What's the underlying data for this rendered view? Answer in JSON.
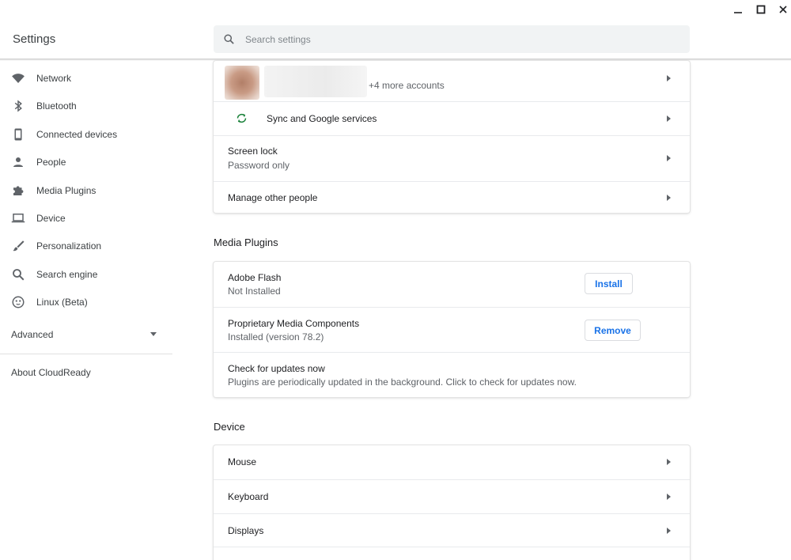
{
  "app": {
    "title": "Settings"
  },
  "search": {
    "placeholder": "Search settings"
  },
  "sidebar": {
    "items": [
      {
        "label": "Network",
        "icon": "wifi-icon"
      },
      {
        "label": "Bluetooth",
        "icon": "bluetooth-icon"
      },
      {
        "label": "Connected devices",
        "icon": "phone-icon"
      },
      {
        "label": "People",
        "icon": "person-icon"
      },
      {
        "label": "Media Plugins",
        "icon": "puzzle-icon"
      },
      {
        "label": "Device",
        "icon": "laptop-icon"
      },
      {
        "label": "Personalization",
        "icon": "brush-icon"
      },
      {
        "label": "Search engine",
        "icon": "search-icon"
      },
      {
        "label": "Linux (Beta)",
        "icon": "penguin-icon"
      }
    ],
    "advanced": "Advanced",
    "about": "About CloudReady"
  },
  "people": {
    "accounts_more": "+4 more accounts",
    "sync": "Sync and Google services",
    "screen_lock": "Screen lock",
    "screen_lock_sub": "Password only",
    "manage": "Manage other people"
  },
  "media_plugins": {
    "title": "Media Plugins",
    "flash": "Adobe Flash",
    "flash_status": "Not Installed",
    "install": "Install",
    "proprietary": "Proprietary Media Components",
    "proprietary_status": "Installed (version 78.2)",
    "remove": "Remove",
    "check": "Check for updates now",
    "check_sub": "Plugins are periodically updated in the background. Click to check for updates now."
  },
  "device": {
    "title": "Device",
    "mouse": "Mouse",
    "keyboard": "Keyboard",
    "displays": "Displays"
  },
  "colors": {
    "accent": "#1a73e8",
    "icon": "#5f6368",
    "sync_icon": "#188038"
  }
}
